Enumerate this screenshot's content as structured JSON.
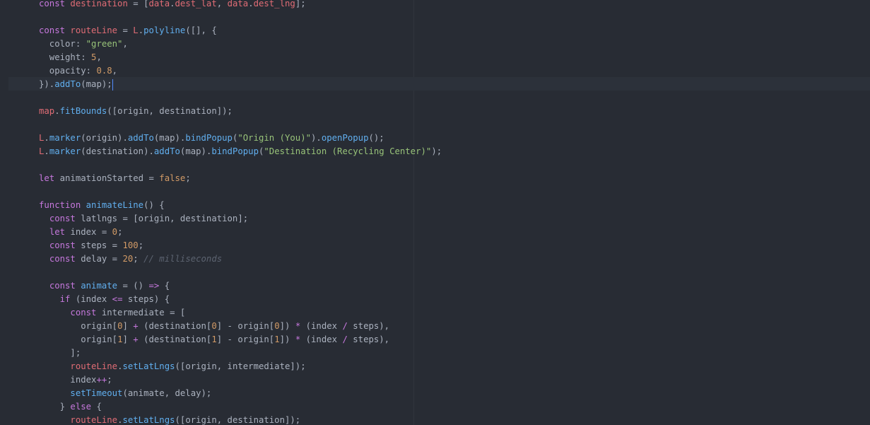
{
  "editor": {
    "colors": {
      "background": "#282c34",
      "current_line": "#2c313a",
      "cursor": "#528bff"
    },
    "lines": [
      [
        {
          "t": "const ",
          "c": "kw"
        },
        {
          "t": "destination",
          "c": "var"
        },
        {
          "t": " = [",
          "c": "pl"
        },
        {
          "t": "data",
          "c": "var"
        },
        {
          "t": ".",
          "c": "pl"
        },
        {
          "t": "dest_lat",
          "c": "var"
        },
        {
          "t": ", ",
          "c": "pl"
        },
        {
          "t": "data",
          "c": "var"
        },
        {
          "t": ".",
          "c": "pl"
        },
        {
          "t": "dest_lng",
          "c": "var"
        },
        {
          "t": "];",
          "c": "pl"
        }
      ],
      [],
      [
        {
          "t": "const ",
          "c": "kw"
        },
        {
          "t": "routeLine",
          "c": "var"
        },
        {
          "t": " = ",
          "c": "pl"
        },
        {
          "t": "L",
          "c": "var"
        },
        {
          "t": ".",
          "c": "pl"
        },
        {
          "t": "polyline",
          "c": "fn"
        },
        {
          "t": "([], {",
          "c": "pl"
        }
      ],
      [
        {
          "t": "  color: ",
          "c": "pl"
        },
        {
          "t": "\"green\"",
          "c": "str"
        },
        {
          "t": ",",
          "c": "pl"
        }
      ],
      [
        {
          "t": "  weight: ",
          "c": "pl"
        },
        {
          "t": "5",
          "c": "num"
        },
        {
          "t": ",",
          "c": "pl"
        }
      ],
      [
        {
          "t": "  opacity: ",
          "c": "pl"
        },
        {
          "t": "0.8",
          "c": "num"
        },
        {
          "t": ",",
          "c": "pl"
        }
      ],
      [
        {
          "t": "}).",
          "c": "pl"
        },
        {
          "t": "addTo",
          "c": "fn"
        },
        {
          "t": "(map);",
          "c": "pl"
        }
      ],
      [],
      [
        {
          "t": "map",
          "c": "var"
        },
        {
          "t": ".",
          "c": "pl"
        },
        {
          "t": "fitBounds",
          "c": "fn"
        },
        {
          "t": "([origin, destination]);",
          "c": "pl"
        }
      ],
      [],
      [
        {
          "t": "L",
          "c": "var"
        },
        {
          "t": ".",
          "c": "pl"
        },
        {
          "t": "marker",
          "c": "fn"
        },
        {
          "t": "(origin).",
          "c": "pl"
        },
        {
          "t": "addTo",
          "c": "fn"
        },
        {
          "t": "(map).",
          "c": "pl"
        },
        {
          "t": "bindPopup",
          "c": "fn"
        },
        {
          "t": "(",
          "c": "pl"
        },
        {
          "t": "\"Origin (You)\"",
          "c": "str"
        },
        {
          "t": ").",
          "c": "pl"
        },
        {
          "t": "openPopup",
          "c": "fn"
        },
        {
          "t": "();",
          "c": "pl"
        }
      ],
      [
        {
          "t": "L",
          "c": "var"
        },
        {
          "t": ".",
          "c": "pl"
        },
        {
          "t": "marker",
          "c": "fn"
        },
        {
          "t": "(destination).",
          "c": "pl"
        },
        {
          "t": "addTo",
          "c": "fn"
        },
        {
          "t": "(map).",
          "c": "pl"
        },
        {
          "t": "bindPopup",
          "c": "fn"
        },
        {
          "t": "(",
          "c": "pl"
        },
        {
          "t": "\"Destination (Recycling Center)\"",
          "c": "str"
        },
        {
          "t": ");",
          "c": "pl"
        }
      ],
      [],
      [
        {
          "t": "let ",
          "c": "kw"
        },
        {
          "t": "animationStarted = ",
          "c": "pl"
        },
        {
          "t": "false",
          "c": "num"
        },
        {
          "t": ";",
          "c": "pl"
        }
      ],
      [],
      [
        {
          "t": "function ",
          "c": "kw"
        },
        {
          "t": "animateLine",
          "c": "fn"
        },
        {
          "t": "() {",
          "c": "pl"
        }
      ],
      [
        {
          "t": "  ",
          "c": "pl"
        },
        {
          "t": "const ",
          "c": "kw"
        },
        {
          "t": "latlngs = [origin, destination];",
          "c": "pl"
        }
      ],
      [
        {
          "t": "  ",
          "c": "pl"
        },
        {
          "t": "let ",
          "c": "kw"
        },
        {
          "t": "index = ",
          "c": "pl"
        },
        {
          "t": "0",
          "c": "num"
        },
        {
          "t": ";",
          "c": "pl"
        }
      ],
      [
        {
          "t": "  ",
          "c": "pl"
        },
        {
          "t": "const ",
          "c": "kw"
        },
        {
          "t": "steps = ",
          "c": "pl"
        },
        {
          "t": "100",
          "c": "num"
        },
        {
          "t": ";",
          "c": "pl"
        }
      ],
      [
        {
          "t": "  ",
          "c": "pl"
        },
        {
          "t": "const ",
          "c": "kw"
        },
        {
          "t": "delay = ",
          "c": "pl"
        },
        {
          "t": "20",
          "c": "num"
        },
        {
          "t": "; ",
          "c": "pl"
        },
        {
          "t": "// milliseconds",
          "c": "cm"
        }
      ],
      [],
      [
        {
          "t": "  ",
          "c": "pl"
        },
        {
          "t": "const ",
          "c": "kw"
        },
        {
          "t": "animate",
          "c": "fn"
        },
        {
          "t": " = () ",
          "c": "pl"
        },
        {
          "t": "=>",
          "c": "op"
        },
        {
          "t": " {",
          "c": "pl"
        }
      ],
      [
        {
          "t": "    ",
          "c": "pl"
        },
        {
          "t": "if ",
          "c": "kw"
        },
        {
          "t": "(index ",
          "c": "pl"
        },
        {
          "t": "<=",
          "c": "op"
        },
        {
          "t": " steps) {",
          "c": "pl"
        }
      ],
      [
        {
          "t": "      ",
          "c": "pl"
        },
        {
          "t": "const ",
          "c": "kw"
        },
        {
          "t": "intermediate = [",
          "c": "pl"
        }
      ],
      [
        {
          "t": "        origin[",
          "c": "pl"
        },
        {
          "t": "0",
          "c": "num"
        },
        {
          "t": "] ",
          "c": "pl"
        },
        {
          "t": "+",
          "c": "op"
        },
        {
          "t": " (destination[",
          "c": "pl"
        },
        {
          "t": "0",
          "c": "num"
        },
        {
          "t": "] - origin[",
          "c": "pl"
        },
        {
          "t": "0",
          "c": "num"
        },
        {
          "t": "]) ",
          "c": "pl"
        },
        {
          "t": "*",
          "c": "op"
        },
        {
          "t": " (index ",
          "c": "pl"
        },
        {
          "t": "/",
          "c": "op"
        },
        {
          "t": " steps),",
          "c": "pl"
        }
      ],
      [
        {
          "t": "        origin[",
          "c": "pl"
        },
        {
          "t": "1",
          "c": "num"
        },
        {
          "t": "] ",
          "c": "pl"
        },
        {
          "t": "+",
          "c": "op"
        },
        {
          "t": " (destination[",
          "c": "pl"
        },
        {
          "t": "1",
          "c": "num"
        },
        {
          "t": "] - origin[",
          "c": "pl"
        },
        {
          "t": "1",
          "c": "num"
        },
        {
          "t": "]) ",
          "c": "pl"
        },
        {
          "t": "*",
          "c": "op"
        },
        {
          "t": " (index ",
          "c": "pl"
        },
        {
          "t": "/",
          "c": "op"
        },
        {
          "t": " steps),",
          "c": "pl"
        }
      ],
      [
        {
          "t": "      ];",
          "c": "pl"
        }
      ],
      [
        {
          "t": "      ",
          "c": "pl"
        },
        {
          "t": "routeLine",
          "c": "var"
        },
        {
          "t": ".",
          "c": "pl"
        },
        {
          "t": "setLatLngs",
          "c": "fn"
        },
        {
          "t": "([origin, intermediate]);",
          "c": "pl"
        }
      ],
      [
        {
          "t": "      index",
          "c": "pl"
        },
        {
          "t": "++",
          "c": "op"
        },
        {
          "t": ";",
          "c": "pl"
        }
      ],
      [
        {
          "t": "      ",
          "c": "pl"
        },
        {
          "t": "setTimeout",
          "c": "fn"
        },
        {
          "t": "(animate, delay);",
          "c": "pl"
        }
      ],
      [
        {
          "t": "    } ",
          "c": "pl"
        },
        {
          "t": "else",
          "c": "kw"
        },
        {
          "t": " {",
          "c": "pl"
        }
      ],
      [
        {
          "t": "      ",
          "c": "pl"
        },
        {
          "t": "routeLine",
          "c": "var"
        },
        {
          "t": ".",
          "c": "pl"
        },
        {
          "t": "setLatLngs",
          "c": "fn"
        },
        {
          "t": "([origin, destination]);",
          "c": "pl"
        }
      ]
    ]
  }
}
